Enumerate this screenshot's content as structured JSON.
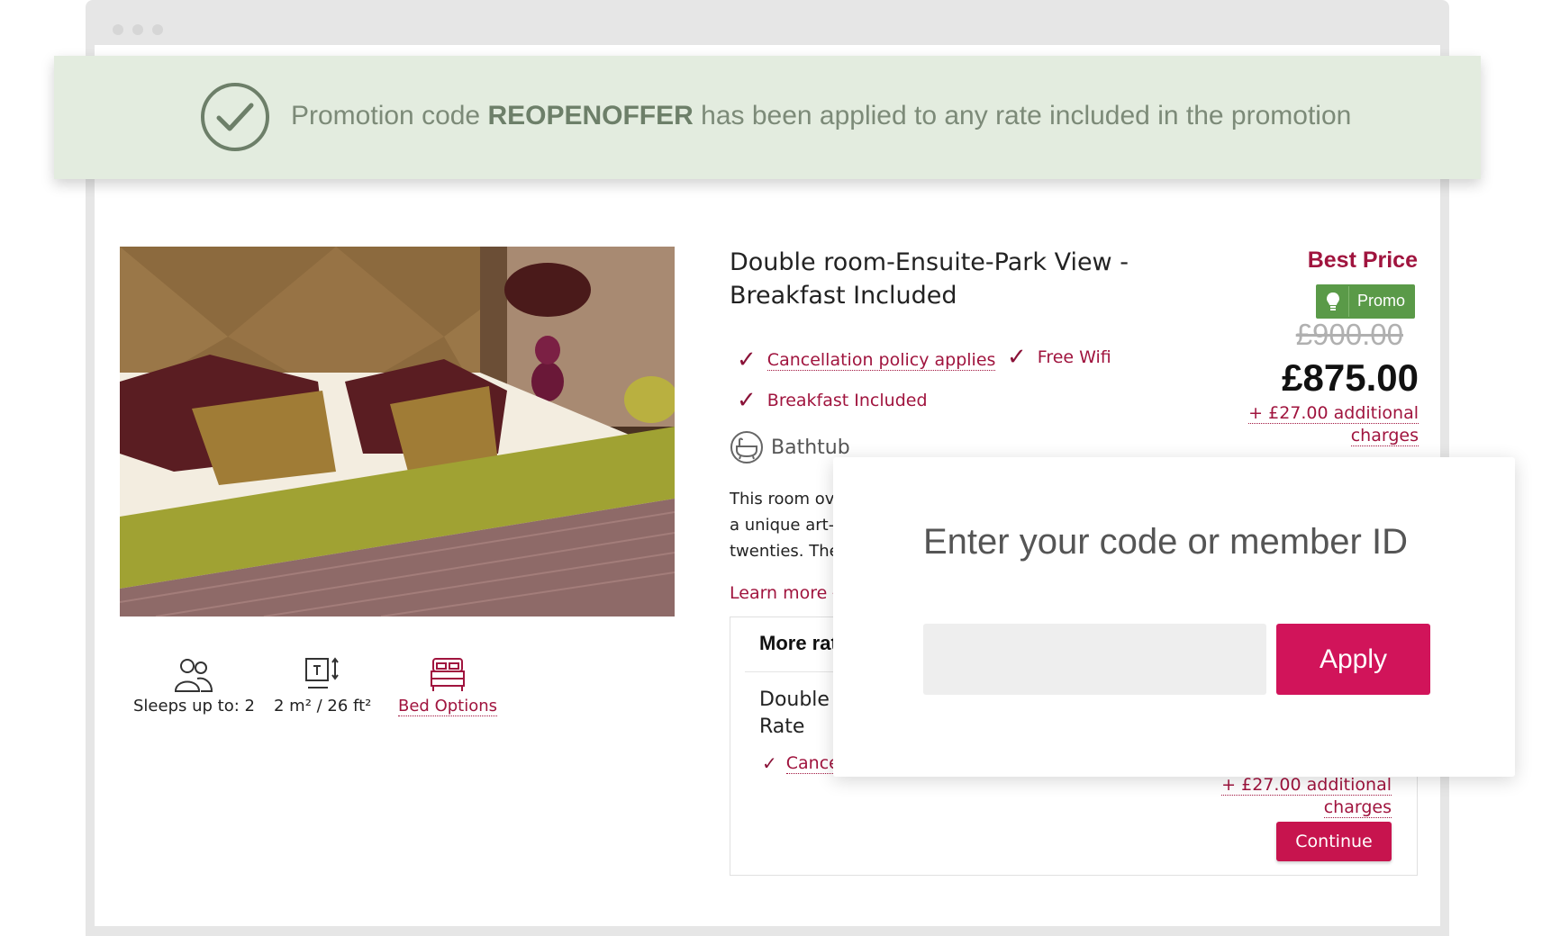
{
  "promo_banner": {
    "prefix": "Promotion code ",
    "code": "REOPENOFFER",
    "suffix": " has been applied to any rate included in the promotion"
  },
  "room": {
    "title": "Double room-Ensuite-Park View - Breakfast Included",
    "amenities": {
      "cancellation": "Cancellation policy applies",
      "wifi": "Free Wifi",
      "breakfast": "Breakfast Included"
    },
    "bathtub": "Bathtub",
    "description": {
      "line1": "This room ov",
      "line2": "a unique art-",
      "line3": "twenties. The"
    },
    "learn_more": "Learn more",
    "features": {
      "sleeps": "Sleeps up to: 2",
      "size": "2 m² / 26 ft²",
      "bed_options": "Bed Options"
    }
  },
  "pricing": {
    "badge": "Best Price",
    "promo_label": "Promo",
    "old_price": "£900.00",
    "new_price": "£875.00",
    "charges_line1": "+ £27.00 additional",
    "charges_line2": "charges"
  },
  "more_rates": {
    "title": "More rat",
    "rate_name_line1": "Double",
    "rate_name_line2": "Rate",
    "cancel_text": "Cance",
    "charges_line1": "+ £27.00 additional",
    "charges_line2": "charges",
    "continue_label": "Continue"
  },
  "code_popup": {
    "title": "Enter your code or member ID",
    "input_value": "",
    "apply_label": "Apply"
  },
  "colors": {
    "accent": "#a0143e",
    "button": "#d1145a",
    "promo_green": "#5a9a48",
    "banner_bg": "#e3ecdf"
  }
}
